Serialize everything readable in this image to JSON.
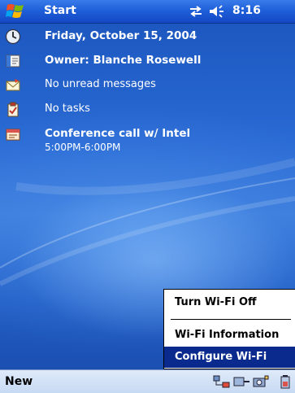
{
  "titlebar": {
    "start_label": "Start",
    "clock": "8:16",
    "icons": [
      "windows-flag-icon",
      "connectivity-icon",
      "volume-icon"
    ]
  },
  "today": {
    "date": "Friday, October 15, 2004",
    "owner": "Owner: Blanche Rosewell",
    "messages": "No unread messages",
    "tasks": "No tasks",
    "appointment": {
      "title": "Conference call w/ Intel",
      "time": "5:00PM-6:00PM"
    }
  },
  "context_menu": {
    "items": [
      {
        "label": "Turn Wi-Fi Off",
        "selected": false
      },
      {
        "label": "Wi-Fi Information",
        "selected": false
      },
      {
        "label": "Configure Wi-Fi",
        "selected": true
      }
    ]
  },
  "menubar": {
    "new_label": "New",
    "tray_icons": [
      "network-icon",
      "wifi-card-icon",
      "camera-icon",
      "battery-icon"
    ]
  },
  "colors": {
    "title_blue": "#1f5fd9",
    "selection_navy": "#0b2a8e",
    "menubar_light": "#dfeaf9"
  }
}
